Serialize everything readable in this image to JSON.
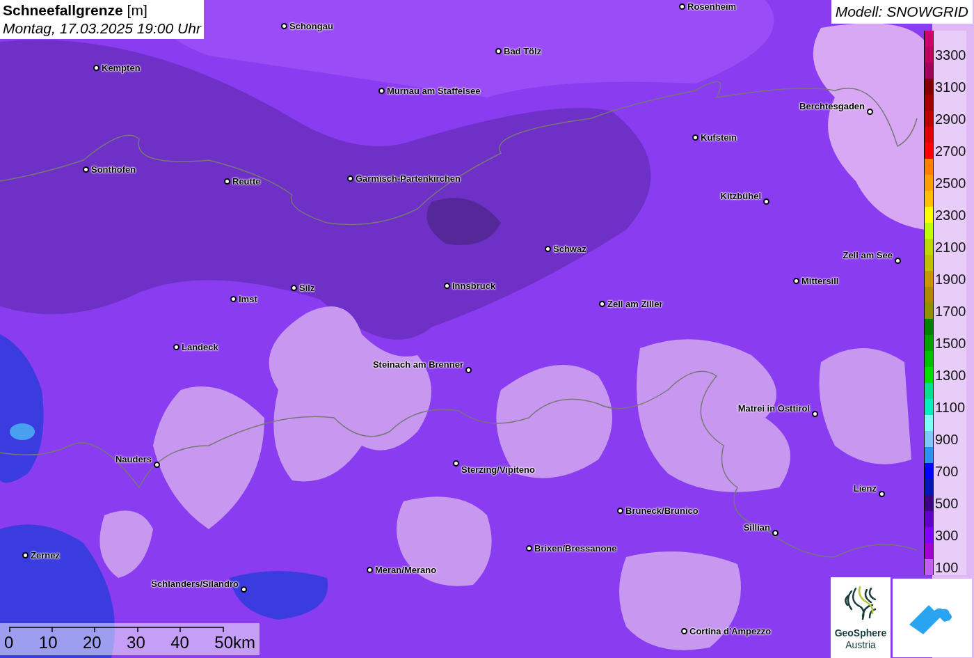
{
  "title": {
    "heading": "**Schneefallgrenze** [m]",
    "subtitle": "Montag, 17.03.2025 19:00 Uhr"
  },
  "model": "Modell: SNOWGRID",
  "cities": [
    {
      "name": "Rosenheim"
    },
    {
      "name": "Schongau"
    },
    {
      "name": "Bad Tölz"
    },
    {
      "name": "Kempten"
    },
    {
      "name": "Murnau am Staffelsee"
    },
    {
      "name": "Berchtesgaden"
    },
    {
      "name": "Kufstein"
    },
    {
      "name": "Sonthofen"
    },
    {
      "name": "Reutte"
    },
    {
      "name": "Garmisch-Partenkirchen"
    },
    {
      "name": "Kitzbühel"
    },
    {
      "name": "Schwaz"
    },
    {
      "name": "Zell am See"
    },
    {
      "name": "Mittersill"
    },
    {
      "name": "Innsbruck"
    },
    {
      "name": "Imst"
    },
    {
      "name": "Silz"
    },
    {
      "name": "Zell am Ziller"
    },
    {
      "name": "Landeck"
    },
    {
      "name": "Steinach am Brenner"
    },
    {
      "name": "Matrei in Osttirol"
    },
    {
      "name": "Nauders"
    },
    {
      "name": "Sterzing/Vipiteno"
    },
    {
      "name": "Lienz"
    },
    {
      "name": "Bruneck/Brunico"
    },
    {
      "name": "Sillian"
    },
    {
      "name": "Brixen/Bressanone"
    },
    {
      "name": "Zernez"
    },
    {
      "name": "Meran/Merano"
    },
    {
      "name": "Schlanders/Silandro"
    },
    {
      "name": "Cortina d'Ampezzo"
    }
  ],
  "legend": [
    {
      "color": "#d00070"
    },
    {
      "label": "3300",
      "color": "#c00060"
    },
    {
      "color": "#a00060"
    },
    {
      "label": "3100",
      "color": "#800000"
    },
    {
      "color": "#a00000"
    },
    {
      "label": "2900",
      "color": "#c00000"
    },
    {
      "color": "#e00000"
    },
    {
      "label": "2700",
      "color": "#ff0000"
    },
    {
      "color": "#ff8000"
    },
    {
      "label": "2500",
      "color": "#ffa000"
    },
    {
      "color": "#ffc000"
    },
    {
      "label": "2300",
      "color": "#ffff00"
    },
    {
      "color": "#c0ff00"
    },
    {
      "label": "2100",
      "color": "#c0d800"
    },
    {
      "color": "#c0c000"
    },
    {
      "label": "1900",
      "color": "#c89600"
    },
    {
      "color": "#b08800"
    },
    {
      "label": "1700",
      "color": "#909000"
    },
    {
      "color": "#008000"
    },
    {
      "label": "1500",
      "color": "#00a000"
    },
    {
      "color": "#00c000"
    },
    {
      "label": "1300",
      "color": "#00e000"
    },
    {
      "color": "#00e090"
    },
    {
      "label": "1100",
      "color": "#00f0c0"
    },
    {
      "color": "#80ffff"
    },
    {
      "label": "900",
      "color": "#80c8ff"
    },
    {
      "color": "#3090f0"
    },
    {
      "label": "700",
      "color": "#0000ff"
    },
    {
      "color": "#0018b0"
    },
    {
      "label": "500",
      "color": "#3c0080"
    },
    {
      "color": "#6000c8"
    },
    {
      "label": "300",
      "color": "#8000ff"
    },
    {
      "color": "#a000d0"
    },
    {
      "label": "100",
      "color": "#c060f0"
    }
  ],
  "scale_bar": [
    "0",
    "10",
    "20",
    "30",
    "40",
    "50km"
  ],
  "logos": {
    "geosphere": [
      "GeoSphere",
      "Austria"
    ]
  }
}
